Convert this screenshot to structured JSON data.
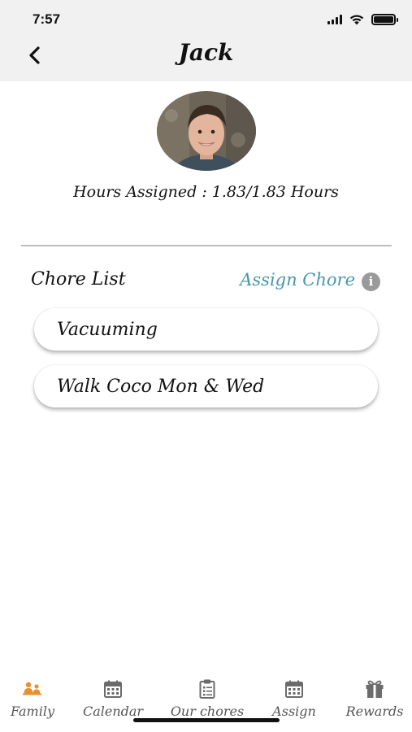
{
  "status_bar": {
    "time": "7:57"
  },
  "header": {
    "title": "Jack",
    "back_icon": "chevron-left-icon"
  },
  "profile": {
    "avatar_alt": "child-photo",
    "hours_assigned": "Hours Assigned : 1.83/1.83 Hours"
  },
  "chores": {
    "section_title": "Chore List",
    "assign_label": "Assign Chore",
    "info_glyph": "i",
    "items": [
      {
        "label": "Vacuuming"
      },
      {
        "label": "Walk Coco Mon & Wed"
      }
    ]
  },
  "tabbar": {
    "tabs": [
      {
        "label": "Family",
        "icon": "family-icon",
        "active": true
      },
      {
        "label": "Calendar",
        "icon": "calendar-icon",
        "active": false
      },
      {
        "label": "Our chores",
        "icon": "clipboard-icon",
        "active": false
      },
      {
        "label": "Assign",
        "icon": "calendar-icon",
        "active": false
      },
      {
        "label": "Rewards",
        "icon": "gift-icon",
        "active": false
      }
    ]
  },
  "colors": {
    "accent": "#4a97a7",
    "active_tab": "#e8912c",
    "header_bg": "#f1f1f1",
    "inactive_icon": "#6b6b6b"
  }
}
